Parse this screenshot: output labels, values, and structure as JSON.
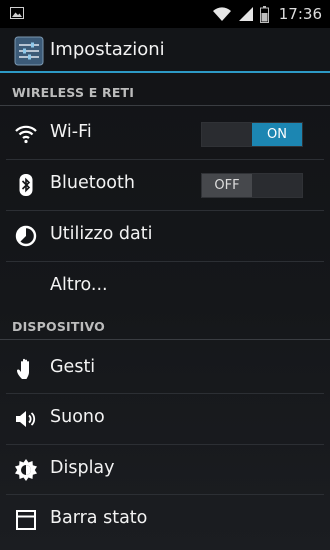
{
  "status_bar": {
    "time": "17:36",
    "icons": [
      "picture-icon",
      "wifi-signal-icon",
      "cell-signal-icon",
      "battery-icon"
    ]
  },
  "action_bar": {
    "title": "Impostazioni",
    "icon": "settings-sliders-icon"
  },
  "sections": {
    "wireless": {
      "header": "WIRELESS E RETI"
    },
    "device": {
      "header": "DISPOSITIVO"
    }
  },
  "items": {
    "wifi": {
      "label": "Wi-Fi",
      "toggle": "ON",
      "icon": "wifi-icon"
    },
    "bluetooth": {
      "label": "Bluetooth",
      "toggle": "OFF",
      "icon": "bluetooth-icon"
    },
    "data_usage": {
      "label": "Utilizzo dati",
      "icon": "data-usage-icon"
    },
    "more": {
      "label": "Altro..."
    },
    "gestures": {
      "label": "Gesti",
      "icon": "hand-icon"
    },
    "sound": {
      "label": "Suono",
      "icon": "speaker-icon"
    },
    "display": {
      "label": "Display",
      "icon": "brightness-icon"
    },
    "status_bar": {
      "label": "Barra stato",
      "icon": "status-bar-icon"
    }
  },
  "colors": {
    "accent": "#2d9ac6",
    "toggle_on": "#1c86b2"
  }
}
